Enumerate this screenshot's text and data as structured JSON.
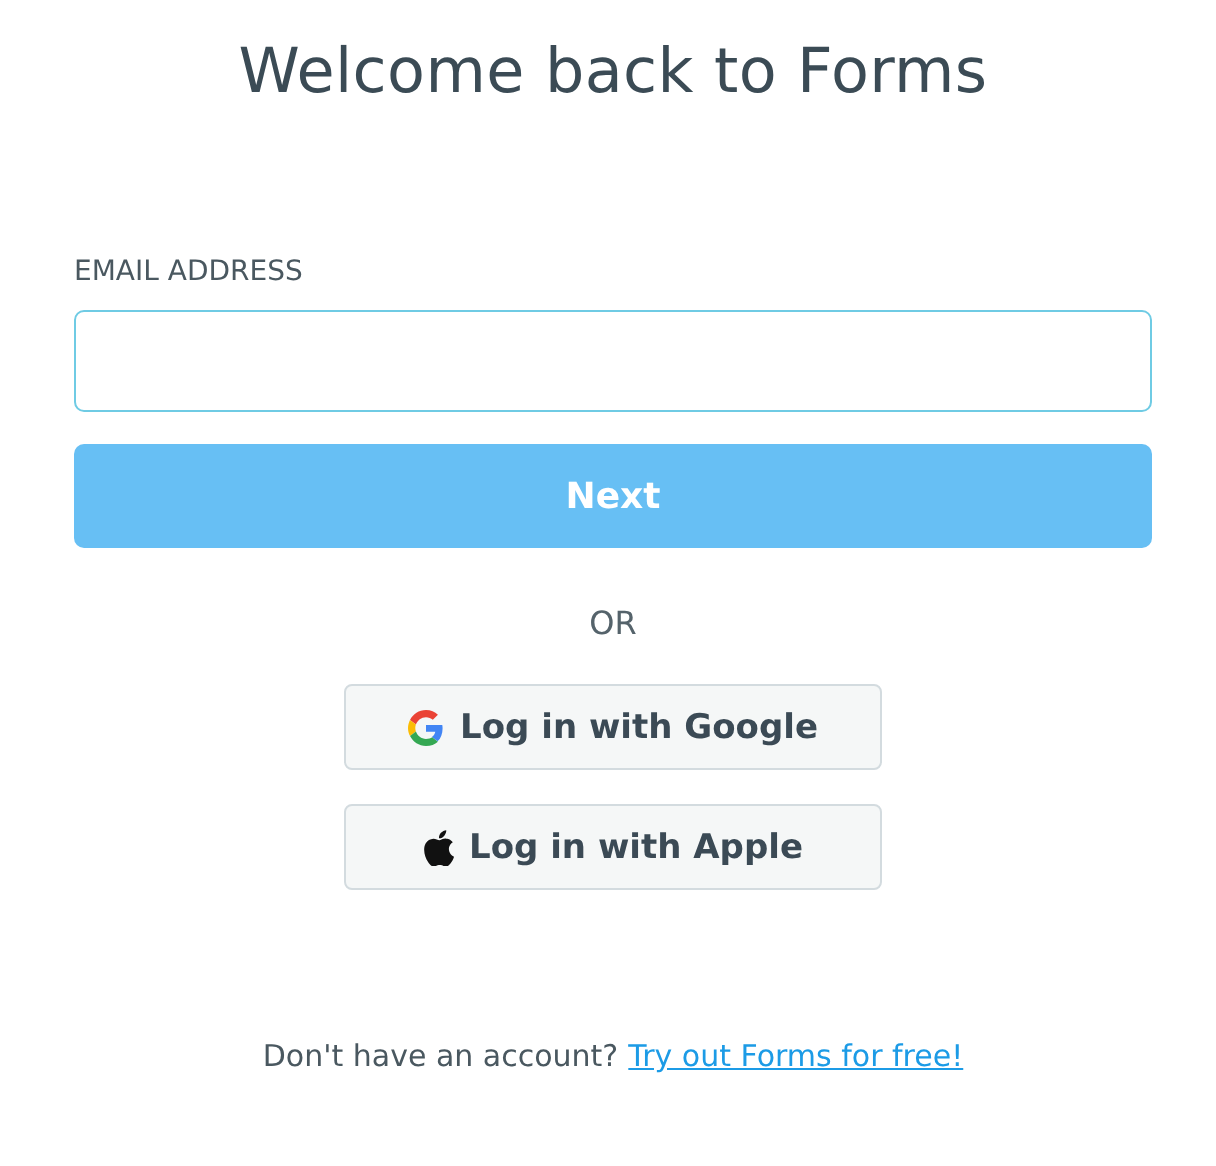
{
  "title": "Welcome back to Forms",
  "email": {
    "label": "EMAIL ADDRESS"
  },
  "next_button": {
    "label": "Next"
  },
  "separator": "OR",
  "social_buttons": [
    {
      "kind": "google",
      "label": "Log in with Google"
    },
    {
      "kind": "apple",
      "label": "Log in with Apple"
    }
  ],
  "footer": {
    "text": "Don't have an account?",
    "link": "Try out Forms for free!"
  }
}
